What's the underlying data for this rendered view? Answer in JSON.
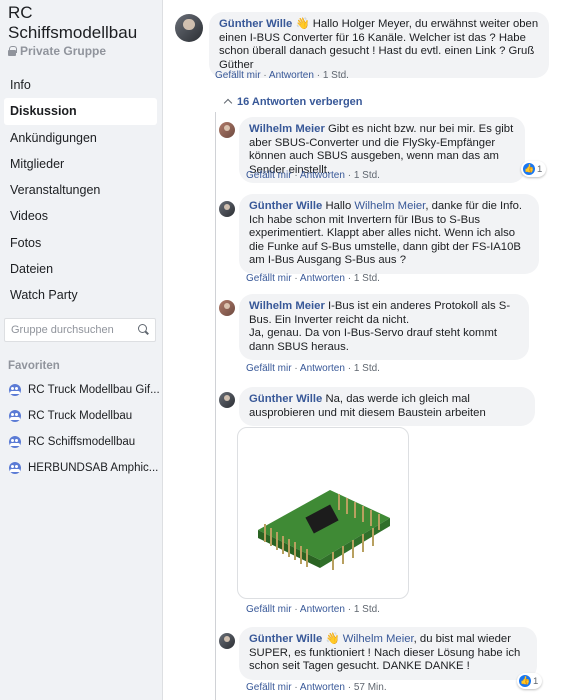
{
  "sidebar": {
    "group_title": "RC Schiffsmodellbau",
    "group_privacy": "Private Gruppe",
    "nav": [
      {
        "label": "Info"
      },
      {
        "label": "Diskussion"
      },
      {
        "label": "Ankündigungen"
      },
      {
        "label": "Mitglieder"
      },
      {
        "label": "Veranstaltungen"
      },
      {
        "label": "Videos"
      },
      {
        "label": "Fotos"
      },
      {
        "label": "Dateien"
      },
      {
        "label": "Watch Party"
      }
    ],
    "search_placeholder": "Gruppe durchsuchen",
    "favorites_heading": "Favoriten",
    "favorites": [
      {
        "label": "RC Truck Modellbau Gif..."
      },
      {
        "label": "RC Truck Modellbau"
      },
      {
        "label": "RC Schiffsmodellbau"
      },
      {
        "label": "HERBUNDSAB Amphic..."
      }
    ]
  },
  "main": {
    "top_comment": {
      "author": "Günther Wille",
      "author_icon": "wave-hand-icon",
      "text": "Hallo Holger Meyer, du erwähnst weiter oben einen I-BUS Converter für 16 Kanäle. Welcher ist das ? Habe schon überall danach gesucht ! Hast du evtl. einen Link ? Gruß Güther",
      "like": "Gefällt mir",
      "reply": "Antworten",
      "time": "1 Std."
    },
    "hide_replies": "16 Antworten verbergen",
    "replies": [
      {
        "author": "Wilhelm Meier",
        "text": "Gibt es nicht bzw. nur bei mir. Es gibt aber SBUS-Converter und die FlySky-Empfänger können auch SBUS ausgeben, wenn man das am Sender einstellt.",
        "like": "Gefällt mir",
        "reply": "Antworten",
        "time": "1 Std.",
        "reactions": "1"
      },
      {
        "author": "Günther Wille",
        "text_pre": "Hallo ",
        "mention": "Wilhelm Meier",
        "text": ", danke für die Info. Ich habe schon mit Invertern für IBus to S-Bus experimentiert. Klappt aber alles nicht. Wenn ich also die Funke auf S-Bus umstelle, dann gibt der FS-IA10B am I-Bus Ausgang S-Bus aus ?",
        "like": "Gefällt mir",
        "reply": "Antworten",
        "time": "1 Std."
      },
      {
        "author": "Wilhelm Meier",
        "text": "I-Bus ist ein anderes Protokoll als S-Bus. Ein Inverter reicht da nicht.",
        "text2": "Ja, genau. Da von I-Bus-Servo drauf steht kommt dann SBUS heraus.",
        "like": "Gefällt mir",
        "reply": "Antworten",
        "time": "1 Std."
      },
      {
        "author": "Günther Wille",
        "text": "Na, das werde ich gleich mal ausprobieren und mit diesem Baustein arbeiten",
        "like": "Gefällt mir",
        "reply": "Antworten",
        "time": "1 Std."
      },
      {
        "author": "Günther Wille",
        "author_icon": "wave-hand-icon",
        "mention": "Wilhelm Meier",
        "text": ", du bist mal wieder SUPER, es funktioniert ! Nach dieser Lösung habe ich schon seit Tagen gesucht. DANKE DANKE !",
        "like": "Gefällt mir",
        "reply": "Antworten",
        "time": "57 Min.",
        "reactions": "1"
      }
    ]
  }
}
